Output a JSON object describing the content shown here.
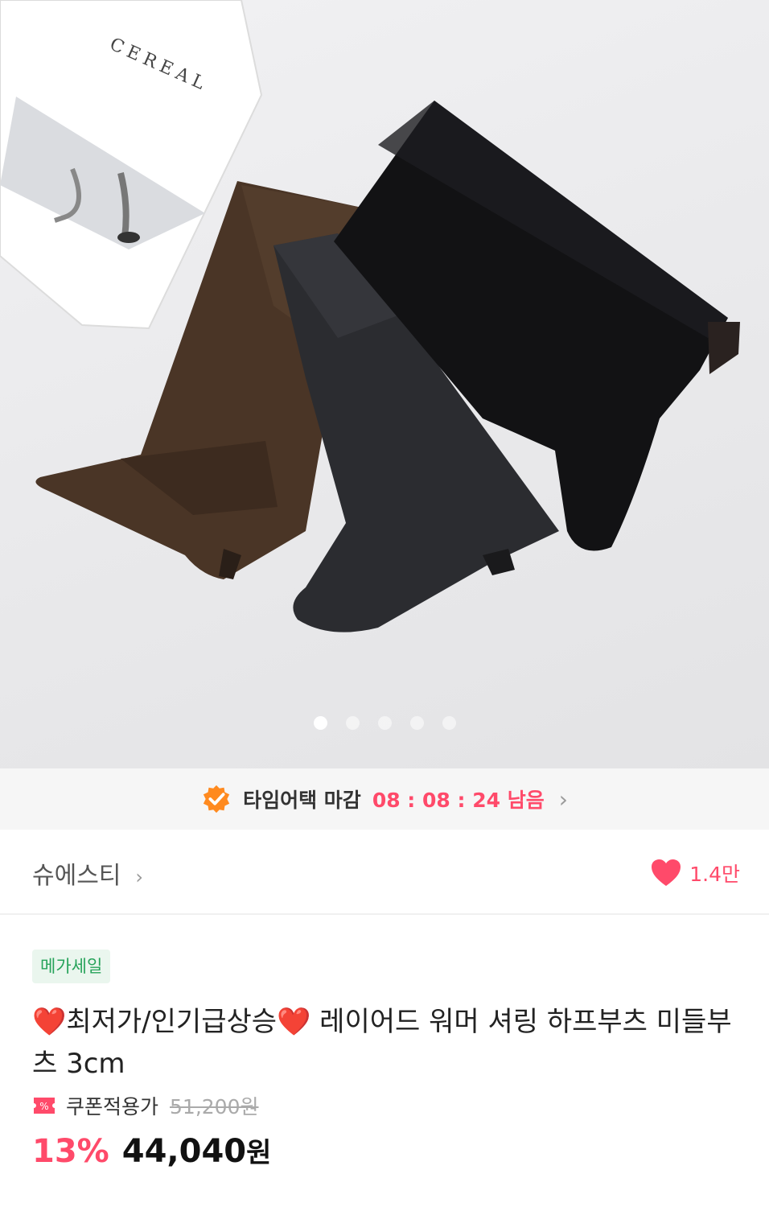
{
  "timer_bar": {
    "label": "타임어택 마감",
    "time": "08 : 08 : 24 남음",
    "chevron": "›"
  },
  "shop": {
    "name": "슈에스티",
    "arrow": "›"
  },
  "likes": {
    "count": "1.4만",
    "icon": "heart-icon",
    "color": "#ff4a6a"
  },
  "product": {
    "tag": "메가세일",
    "title": "❤️최저가/인기급상승❤️ 레이어드 워머 셔링 하프부츠 미들부츠 3cm",
    "coupon_label": "쿠폰적용가",
    "original_price": "51,200원",
    "discount": "13%",
    "price": "44,040",
    "currency": "원"
  },
  "gallery": {
    "slide_count": 5,
    "active_index": 0
  },
  "magazine": {
    "title": "CEREAL"
  },
  "colors": {
    "accent": "#ff4a6a",
    "tag_green": "#26a35a",
    "badge_orange": "#ff8a1f"
  }
}
